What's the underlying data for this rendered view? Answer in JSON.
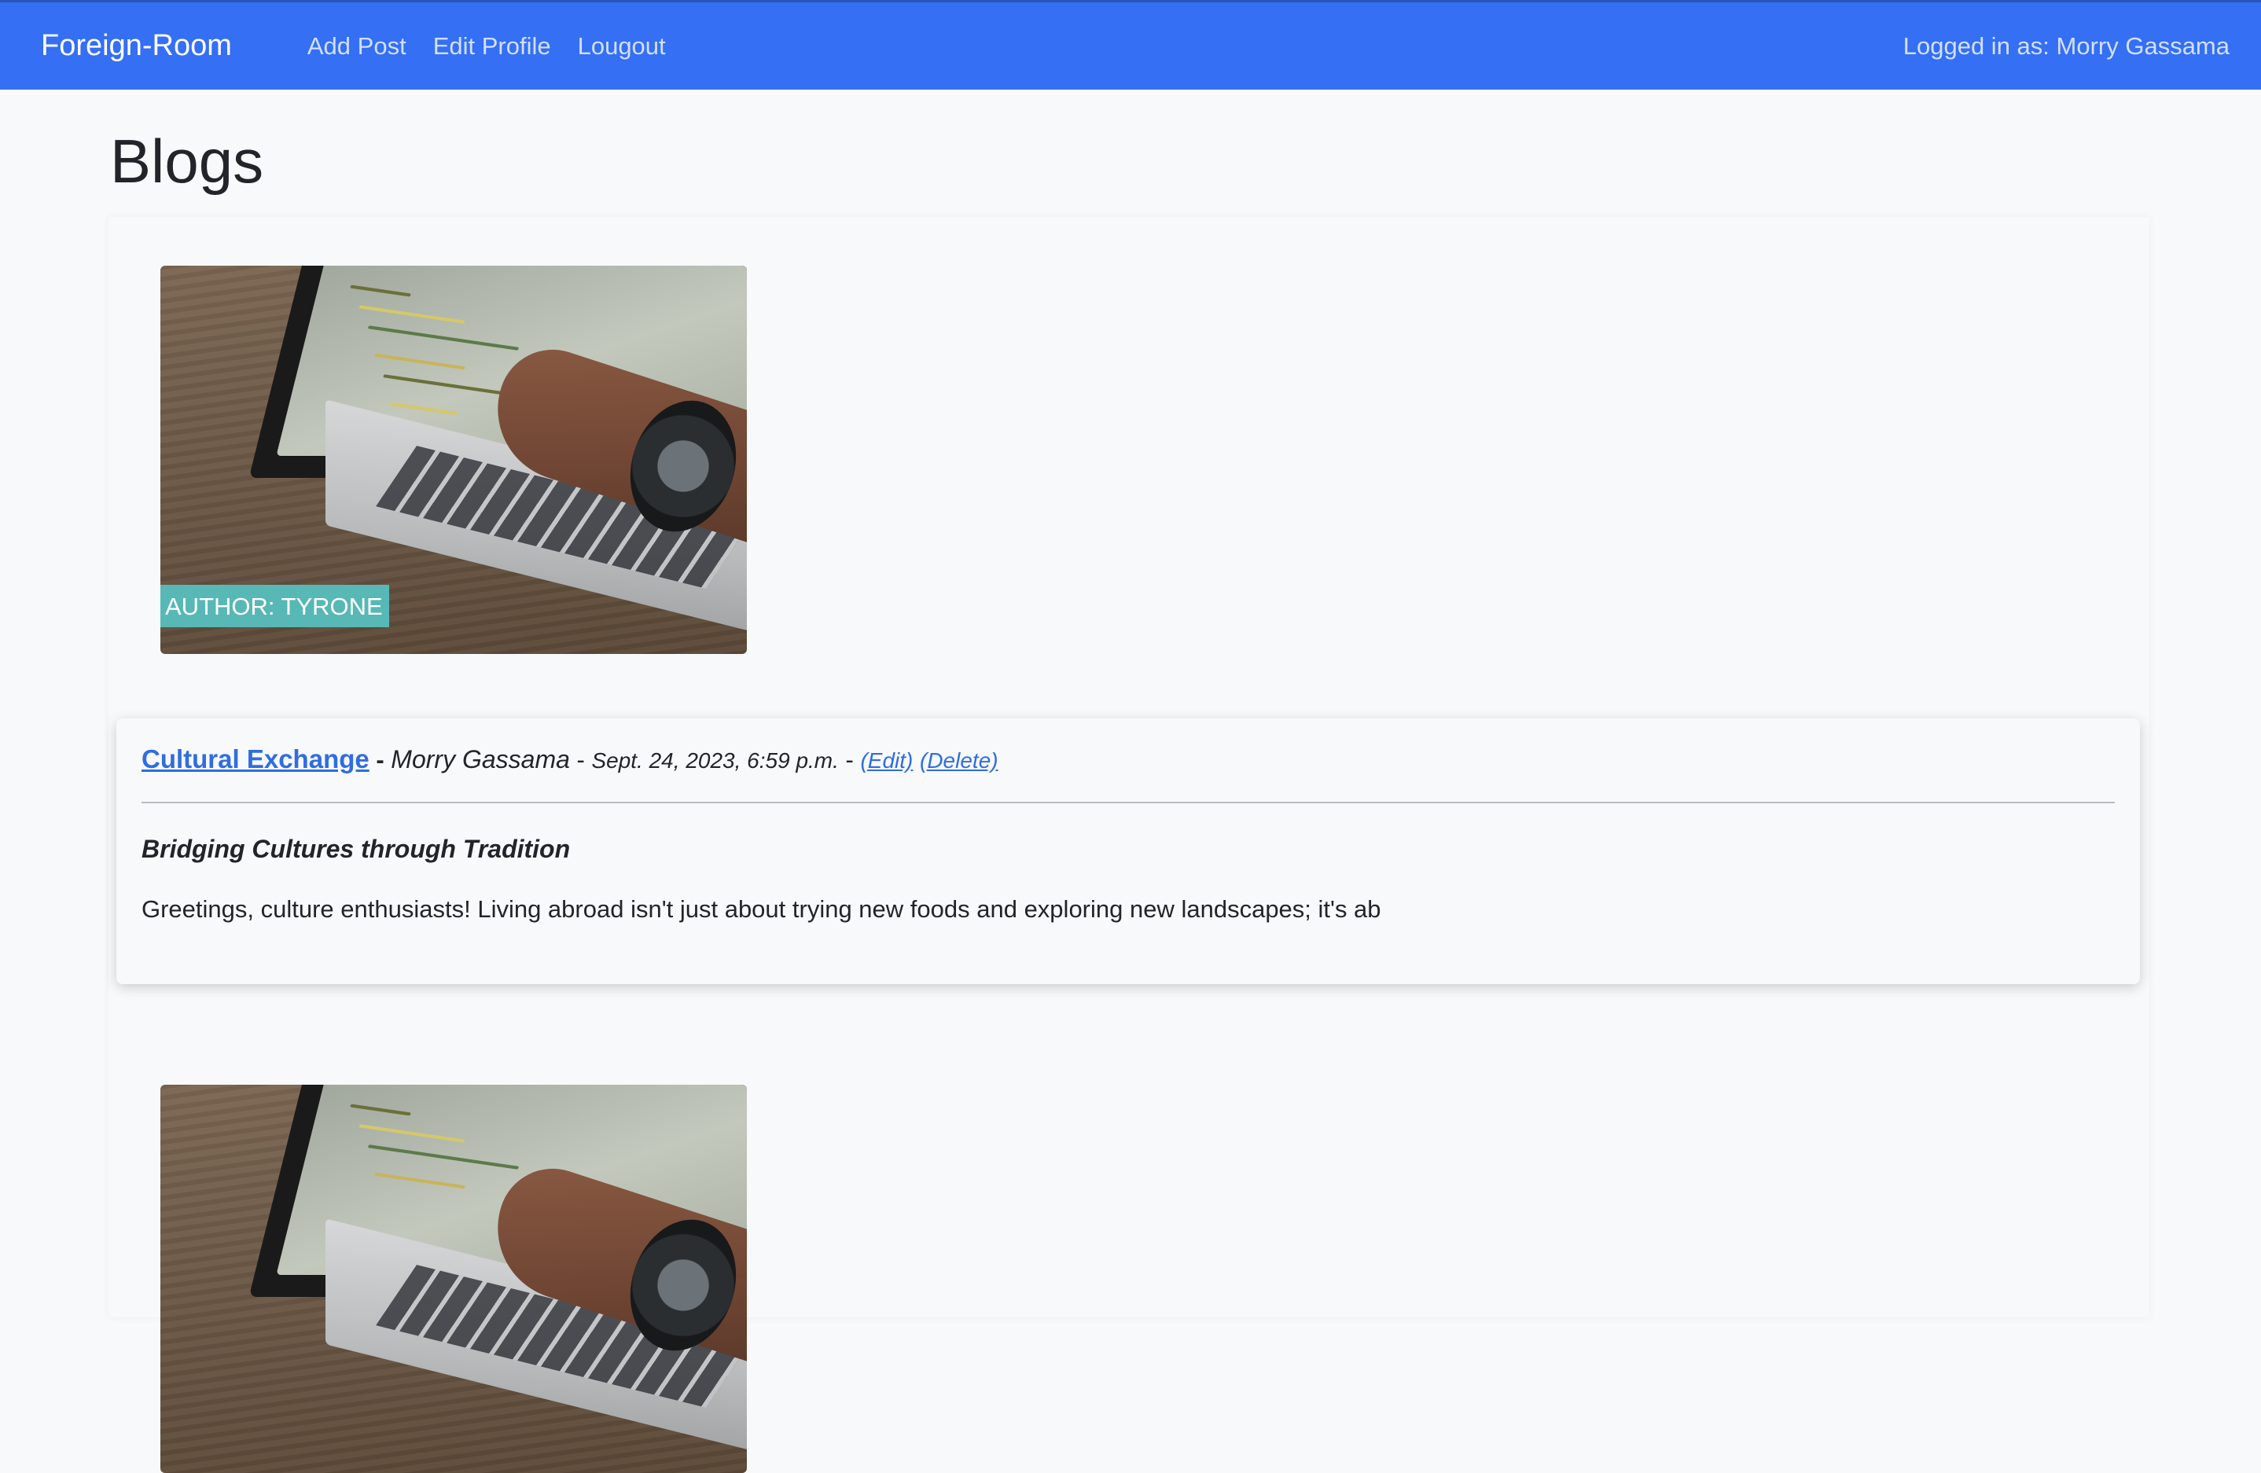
{
  "navbar": {
    "brand": "Foreign-Room",
    "links": [
      "Add Post",
      "Edit Profile",
      "Lougout"
    ],
    "logged_in_text": "Logged in as: Morry Gassama"
  },
  "page": {
    "title": "Blogs"
  },
  "posts": [
    {
      "author_badge": "AUTHOR: TYRONE",
      "title": "Cultural Exchange",
      "author": "Morry Gassama",
      "date": "Sept. 24, 2023, 6:59 p.m.",
      "edit_label": "(Edit)",
      "delete_label": "(Delete)",
      "subtitle": "Bridging Cultures through Tradition",
      "excerpt": "Greetings, culture enthusiasts! Living abroad isn't just about trying new foods and exploring new landscapes; it's ab"
    }
  ],
  "colors": {
    "navbar": "#346ff4",
    "link": "#2f6de0",
    "badge": "#57b8b6",
    "background": "#f8f9fa"
  }
}
